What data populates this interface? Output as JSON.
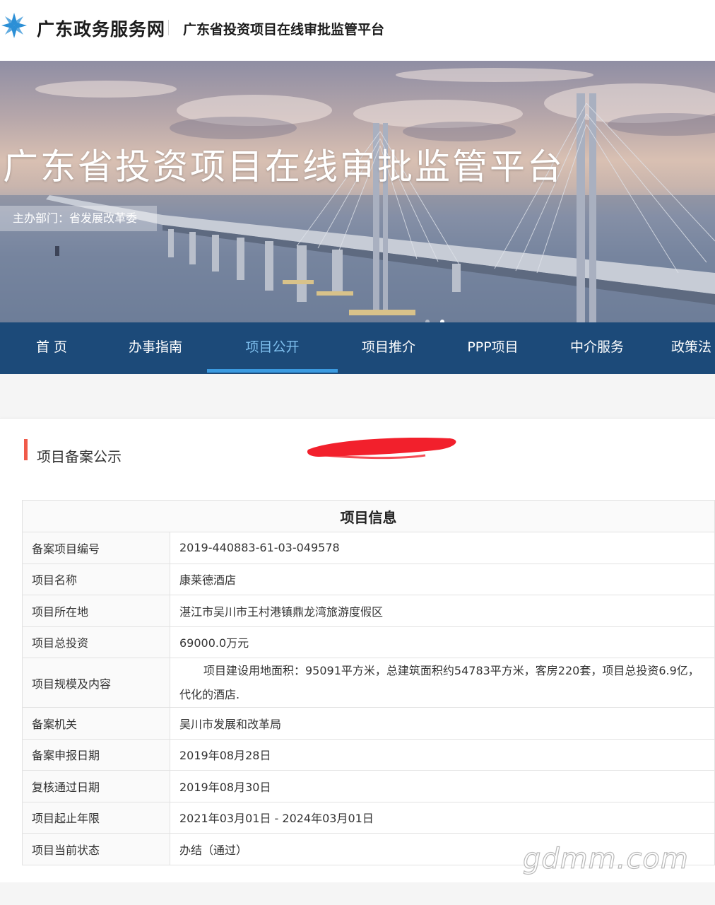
{
  "header": {
    "brand": "广东政务服务网",
    "subtitle": "广东省投资项目在线审批监管平台"
  },
  "banner": {
    "title": "广东省投资项目在线审批监管平台",
    "department": "主办部门：省发展改革委"
  },
  "nav": {
    "items": [
      {
        "label": "首 页"
      },
      {
        "label": "办事指南"
      },
      {
        "label": "项目公开"
      },
      {
        "label": "项目推介"
      },
      {
        "label": "PPP项目"
      },
      {
        "label": "中介服务"
      },
      {
        "label": "政策法"
      }
    ],
    "active_index": 2
  },
  "section": {
    "title": "项目备案公示"
  },
  "table": {
    "header": "项目信息",
    "rows": [
      {
        "label": "备案项目编号",
        "value": "2019-440883-61-03-049578"
      },
      {
        "label": "项目名称",
        "value": "康莱德酒店"
      },
      {
        "label": "项目所在地",
        "value": "湛江市吴川市王村港镇鼎龙湾旅游度假区"
      },
      {
        "label": "项目总投资",
        "value": "69000.0万元"
      },
      {
        "label": "项目规模及内容",
        "value_line1": "项目建设用地面积：95091平方米，总建筑面积约54783平方米，客房220套，项目总投资6.9亿，",
        "value_line2": "代化的酒店."
      },
      {
        "label": "备案机关",
        "value": "吴川市发展和改革局"
      },
      {
        "label": "备案申报日期",
        "value": "2019年08月28日"
      },
      {
        "label": "复核通过日期",
        "value": "2019年08月30日"
      },
      {
        "label": "项目起止年限",
        "value": "2021年03月01日 - 2024年03月01日"
      },
      {
        "label": "项目当前状态",
        "value": "办结（通过）"
      }
    ]
  },
  "watermark": "gdmm.com",
  "colors": {
    "nav_bg": "#1c4a79",
    "nav_active": "#7fc0ef",
    "nav_underline": "#3b9be1",
    "section_accent": "#f05a4a",
    "redaction": "#f2202c"
  }
}
